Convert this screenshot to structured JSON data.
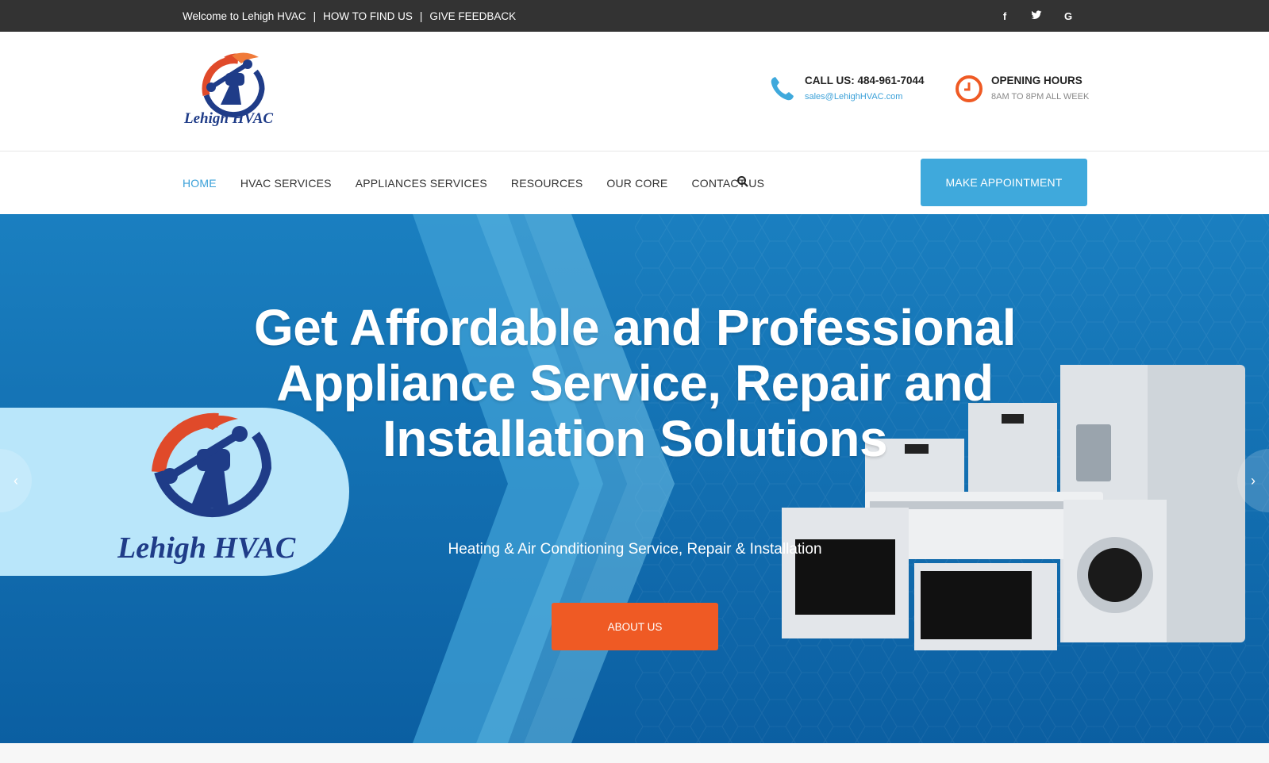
{
  "topbar": {
    "welcome": "Welcome to Lehigh HVAC",
    "sep1": "|",
    "how_to_find": "HOW TO FIND US",
    "sep2": "|",
    "feedback": "GIVE FEEDBACK",
    "social": {
      "facebook": "f",
      "twitter": "twitter-icon",
      "google": "G"
    }
  },
  "header": {
    "logo_text": "Lehigh HVAC",
    "call_title": "CALL US: 484-961-7044",
    "call_email": "sales@LehighHVAC.com",
    "hours_title": "OPENING HOURS",
    "hours_value": "8AM TO 8PM ALL WEEK"
  },
  "nav": {
    "items": [
      {
        "label": "HOME",
        "active": true
      },
      {
        "label": "HVAC SERVICES"
      },
      {
        "label": "APPLIANCES SERVICES"
      },
      {
        "label": "RESOURCES"
      },
      {
        "label": "OUR CORE"
      },
      {
        "label": "CONTACT US"
      }
    ],
    "appointment_label": "MAKE APPOINTMENT"
  },
  "hero": {
    "headline": "Get Affordable and Professional Appliance Service, Repair and Installation Solutions",
    "subtitle": "Heating & Air Conditioning Service, Repair & Installation",
    "cta_label": "ABOUT US",
    "logo_text": "Lehigh HVAC",
    "prev_arrow": "‹",
    "next_arrow": "›"
  },
  "colors": {
    "topbar_bg": "#333333",
    "accent_blue": "#3fa9dc",
    "accent_orange": "#ef5a24",
    "hero_blue": "#0a7cc0",
    "logo_navy": "#1f3c88",
    "logo_red": "#e04a2a"
  }
}
